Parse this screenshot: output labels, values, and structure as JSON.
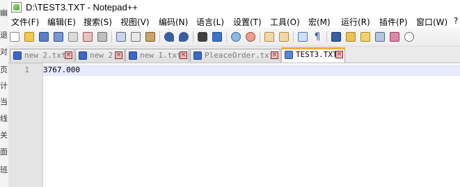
{
  "left_strip": {
    "chars": [
      "幽",
      "退",
      "对",
      "页",
      "计",
      "当",
      "线",
      "关",
      "面",
      "班"
    ]
  },
  "window": {
    "title": "D:\\TEST3.TXT - Notepad++"
  },
  "menu": [
    "文件(F)",
    "编辑(E)",
    "搜索(S)",
    "视图(V)",
    "编码(N)",
    "语言(L)",
    "设置(T)",
    "工具(O)",
    "宏(M)",
    "运行(R)",
    "插件(P)",
    "窗口(W)",
    "?"
  ],
  "toolbar": {
    "buttons": [
      "new-file",
      "open-file",
      "save",
      "save-all",
      "close",
      "close-all",
      "print",
      "cut",
      "copy",
      "paste",
      "undo",
      "redo",
      "find",
      "replace",
      "zoom-in",
      "zoom-out",
      "sync-vertical",
      "sync-horizontal",
      "word-wrap",
      "show-all-chars",
      "indent-guide",
      "user-defined-language",
      "document-map",
      "folder-workspace",
      "monitoring"
    ]
  },
  "tabs": [
    {
      "label": "new 2.txt",
      "active": false
    },
    {
      "label": "new 2",
      "active": false
    },
    {
      "label": "new 1.txt",
      "active": false
    },
    {
      "label": "PleaceOrder.txt",
      "active": false
    },
    {
      "label": "TEST3.TXT",
      "active": true
    }
  ],
  "editor": {
    "line_number": "1",
    "content": "3767.000"
  },
  "colors": {
    "active_tab_accent": "#f9a93a",
    "current_line": "#e8e8ff",
    "gutter": "#e4e4e4",
    "file_icon": "#3c67c4"
  }
}
